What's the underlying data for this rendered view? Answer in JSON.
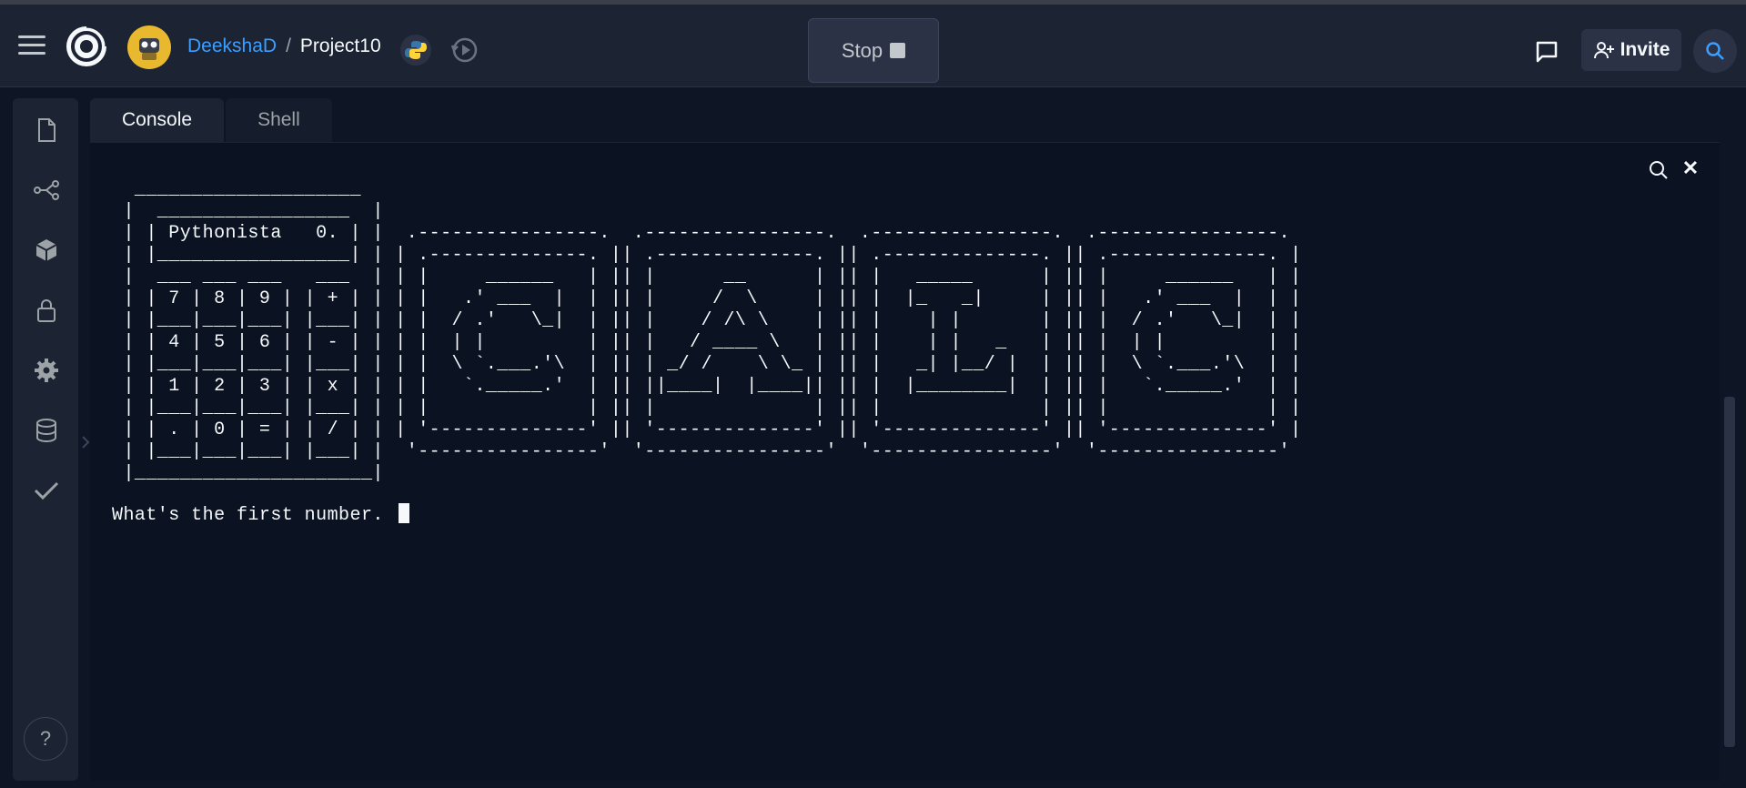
{
  "header": {
    "user": "DeekshaD",
    "separator": "/",
    "project": "Project10",
    "stop_label": "Stop",
    "invite_label": "Invite"
  },
  "tabs": [
    {
      "label": "Console",
      "active": true
    },
    {
      "label": "Shell",
      "active": false
    }
  ],
  "sidebar": {
    "items": [
      "file-icon",
      "git-branch-icon",
      "packages-icon",
      "secrets-lock-icon",
      "settings-gear-icon",
      "database-icon",
      "check-icon"
    ],
    "help_label": "?"
  },
  "console": {
    "ascii_art": "  ____________________\n |  _________________  |\n | | Pythonista   0. | |  .----------------.  .----------------.  .----------------.  .----------------.\n | |_________________| | | .--------------. || .--------------. || .--------------. || .--------------. |\n |  ___ ___ ___   ___  | | |     ______   | || |      __      | || |   _____      | || |     ______   | |\n | | 7 | 8 | 9 | | + | | | |   .' ___  |  | || |     /  \\     | || |  |_   _|     | || |   .' ___  |  | |\n | |___|___|___| |___| | | |  / .'   \\_|  | || |    / /\\ \\    | || |    | |       | || |  / .'   \\_|  | |\n | | 4 | 5 | 6 | | - | | | |  | |         | || |   / ____ \\   | || |    | |   _   | || |  | |         | |\n | |___|___|___| |___| | | |  \\ `.___.'\\  | || | _/ /    \\ \\_ | || |   _| |__/ |  | || |  \\ `.___.'\\  | |\n | | 1 | 2 | 3 | | x | | | |   `._____.'  | || ||____|  |____|| || |  |________|  | || |   `._____.'  | |\n | |___|___|___| |___| | | |              | || |              | || |              | || |              | |\n | | . | 0 | = | | / | | | '--------------' || '--------------' || '--------------' || '--------------' |\n | |___|___|___| |___| |  '----------------'  '----------------'  '----------------'  '----------------'\n |_____________________|",
    "prompt": "What's the first number. "
  },
  "colors": {
    "background": "#0e1525",
    "panel": "#1c2333",
    "accent": "#3c9eff",
    "avatar": "#e8b92e"
  }
}
